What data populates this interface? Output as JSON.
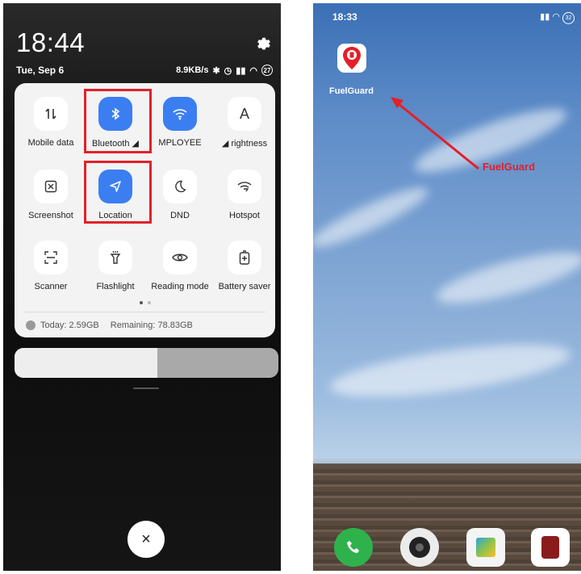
{
  "left_screen": {
    "time": "18:44",
    "date": "Tue, Sep 6",
    "status_bar": {
      "speed": "8.9KB/s",
      "battery": "27"
    },
    "tiles": [
      {
        "label": "Mobile data",
        "icon": "mobile-data-icon",
        "active": false
      },
      {
        "label": "Bluetooth ◢",
        "icon": "bluetooth-icon",
        "active": true
      },
      {
        "label": "MPLOYEE",
        "icon": "wifi-icon",
        "active": true
      },
      {
        "label": "◢ rightness",
        "icon": "auto-brightness-icon",
        "active": false
      },
      {
        "label": "Screenshot",
        "icon": "screenshot-icon",
        "active": false
      },
      {
        "label": "Location",
        "icon": "location-icon",
        "active": true
      },
      {
        "label": "DND",
        "icon": "moon-icon",
        "active": false
      },
      {
        "label": "Hotspot",
        "icon": "hotspot-icon",
        "active": false
      },
      {
        "label": "Scanner",
        "icon": "scanner-icon",
        "active": false
      },
      {
        "label": "Flashlight",
        "icon": "flashlight-icon",
        "active": false
      },
      {
        "label": "Reading mode",
        "icon": "eye-icon",
        "active": false
      },
      {
        "label": "Battery saver",
        "icon": "battery-saver-icon",
        "active": false
      }
    ],
    "data_usage": {
      "today": "Today: 2.59GB",
      "remaining": "Remaining: 78.83GB"
    },
    "brightness_level": 0.54,
    "close_symbol": "×",
    "colors": {
      "active_tile": "#3b7ef2",
      "highlight": "#e3202a"
    }
  },
  "right_screen": {
    "time": "18:33",
    "battery": "32",
    "app": {
      "name": "FuelGuard",
      "icon": "fuel-pin-icon"
    },
    "annotation": "FuelGuard",
    "dock": [
      "phone-icon",
      "camera-icon",
      "gallery-icon",
      "app-icon"
    ]
  }
}
